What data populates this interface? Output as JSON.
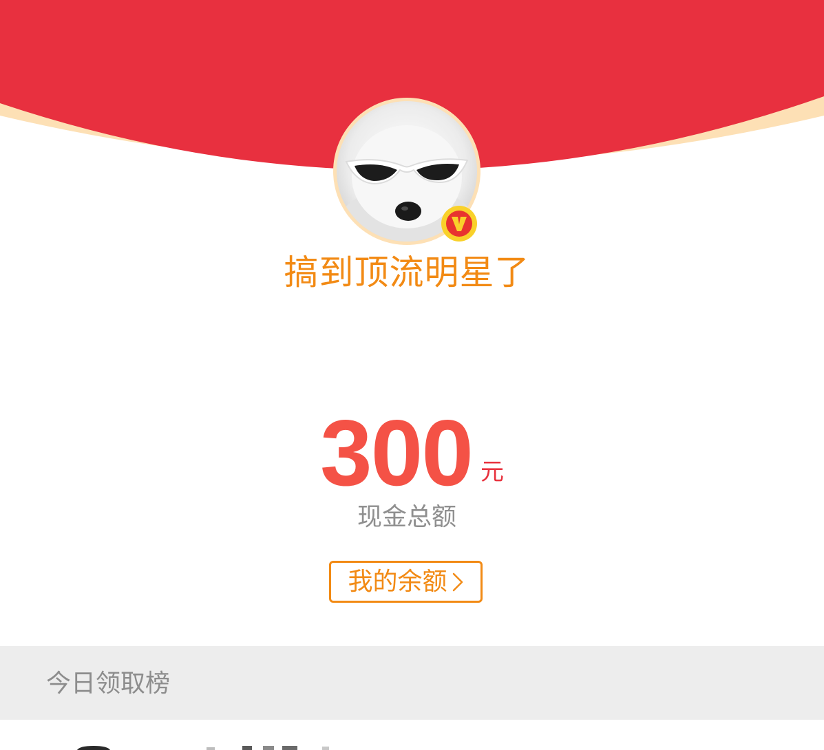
{
  "user": {
    "name": "搞到顶流明星了",
    "verified_badge": "V",
    "avatar": "avatar-dog-with-sunglasses"
  },
  "amount": {
    "value": "300",
    "unit": "元",
    "label": "现金总额"
  },
  "balance_button": {
    "label": "我的余额",
    "icon": "chevron-right-icon"
  },
  "leaderboard": {
    "title": "今日领取榜"
  },
  "colors": {
    "header_red": "#e8303f",
    "header_rim": "#fde0b5",
    "accent_orange": "#f28a14",
    "amount_red": "#f45246",
    "section_bg": "#ededed",
    "muted_text": "#8f8f8f"
  }
}
